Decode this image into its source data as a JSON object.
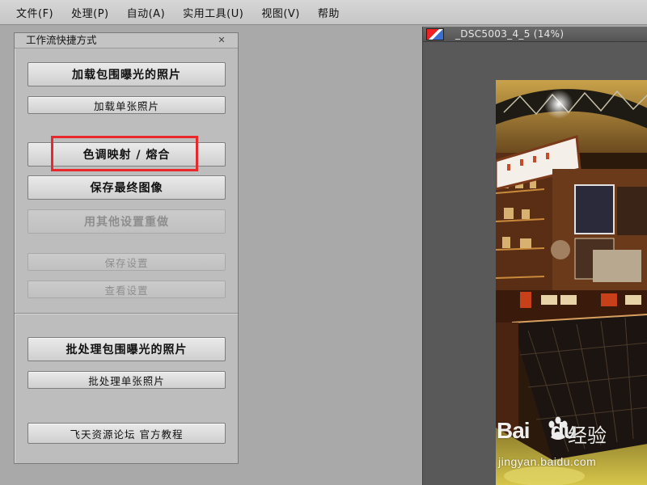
{
  "menubar": {
    "items": [
      "文件(F)",
      "处理(P)",
      "自动(A)",
      "实用工具(U)",
      "视图(V)",
      "帮助"
    ]
  },
  "panel": {
    "title": "工作流快捷方式",
    "close_icon": "close-icon",
    "buttons": {
      "load_bracketed": "加载包围曝光的照片",
      "load_single": "加载单张照片",
      "tone_mapping": "色调映射 / 熔合",
      "save_final": "保存最终图像",
      "redo_other": "用其他设置重做",
      "save_settings": "保存设置",
      "view_settings": "查看设置",
      "batch_bracketed": "批处理包围曝光的照片",
      "batch_single": "批处理单张照片",
      "forum_tutorial": "飞天资源论坛 官方教程"
    }
  },
  "image_window": {
    "title": "_DSC5003_4_5 (14%)"
  },
  "watermark": {
    "brand": "Bai",
    "brand_suffix": "du",
    "product": "经验",
    "url": "jingyan.baidu.com"
  },
  "colors": {
    "highlight": "#e8282a",
    "panel_bg": "#bdbdbd",
    "workspace_bg": "#a9a9a9"
  }
}
